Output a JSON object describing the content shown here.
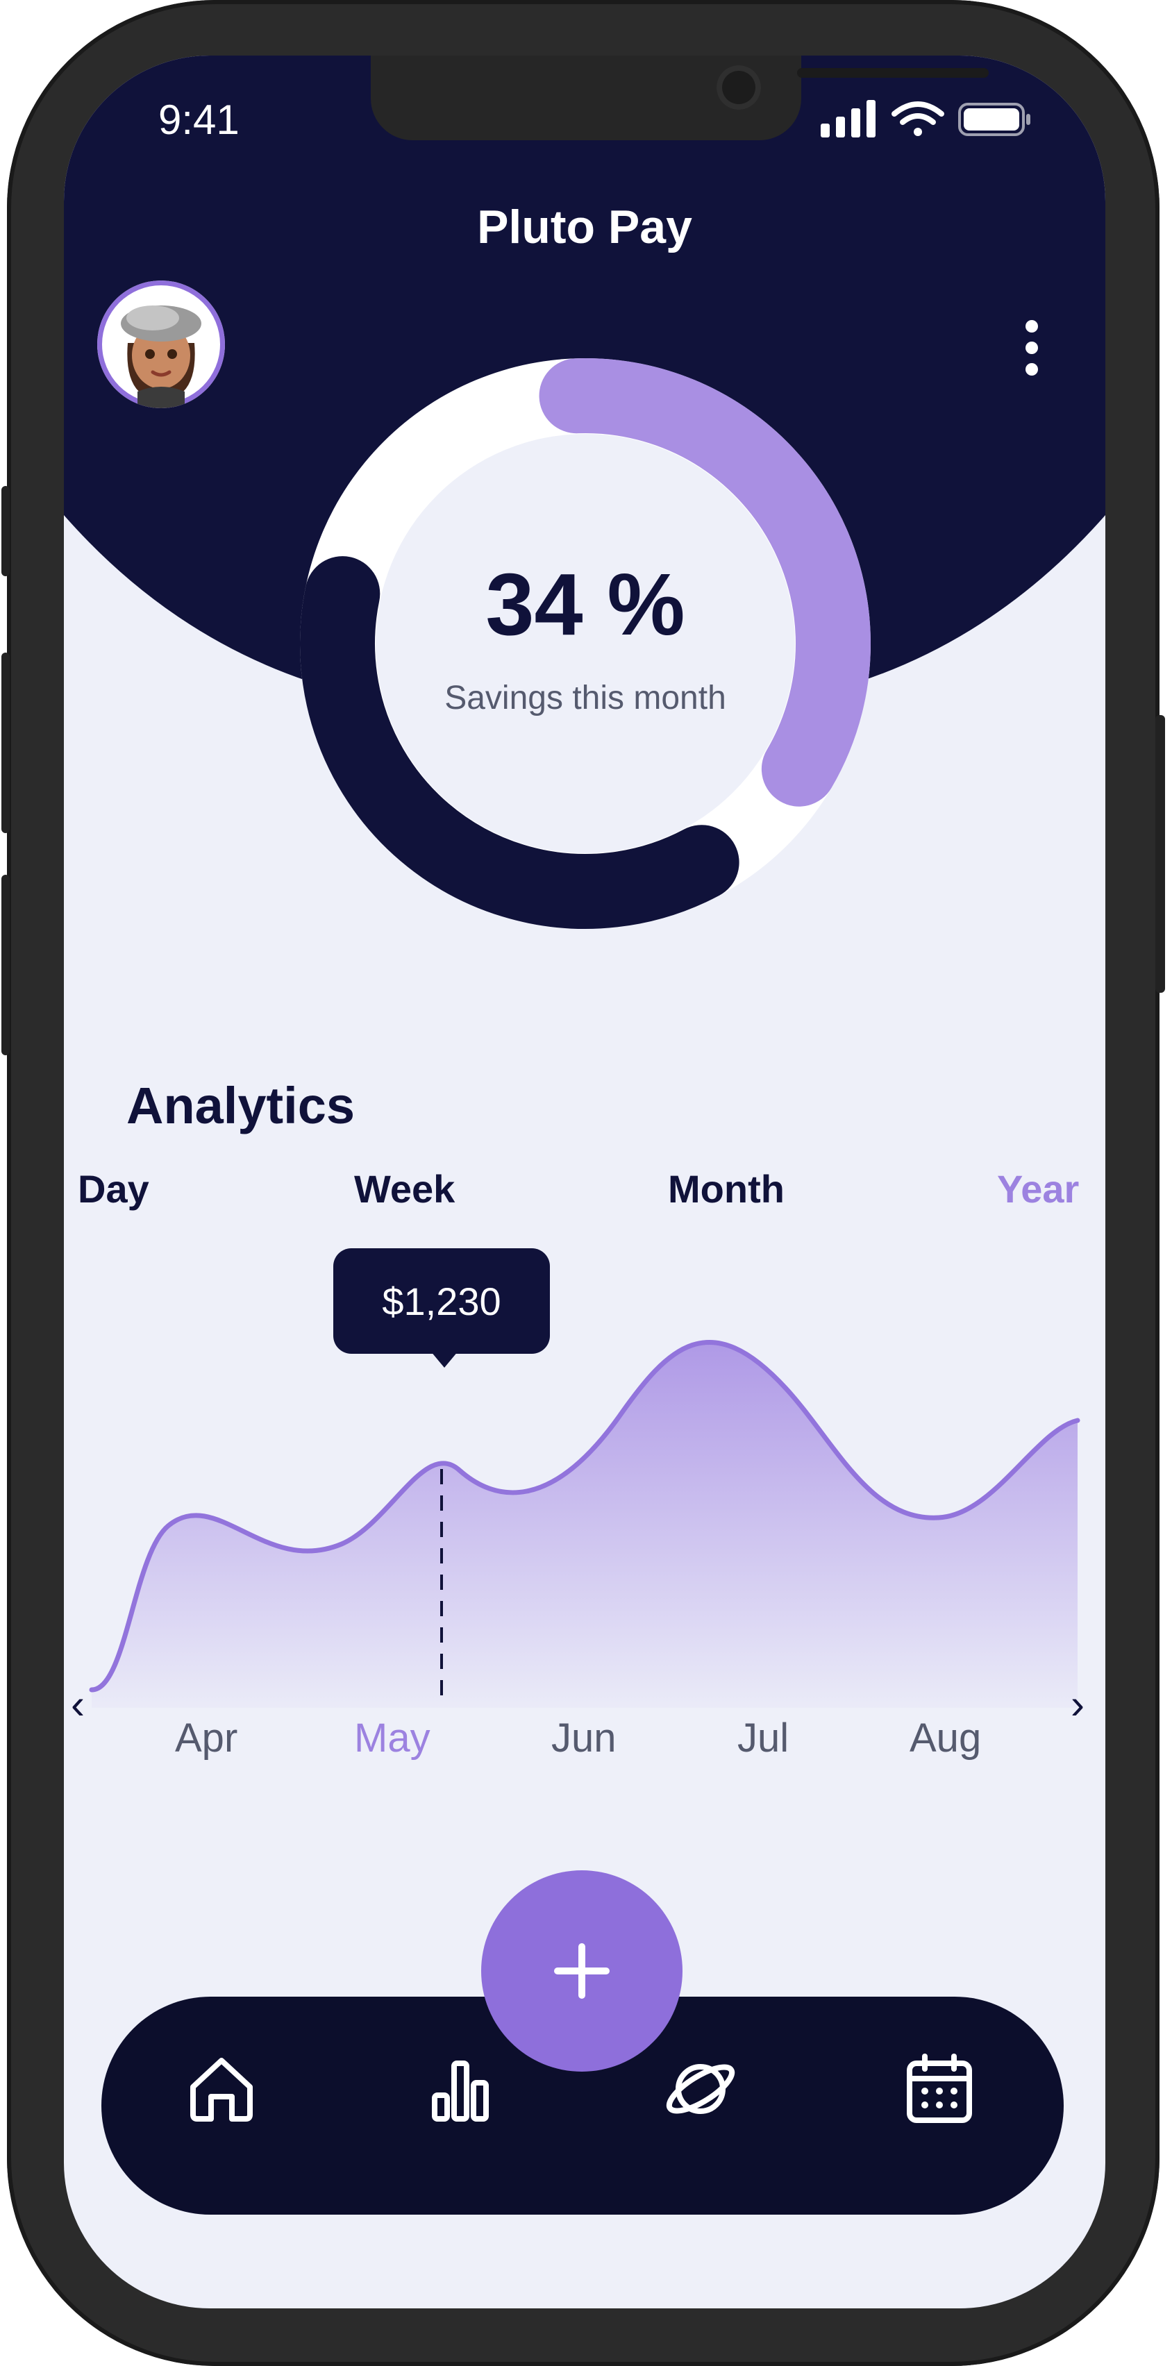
{
  "status_bar": {
    "time": "9:41"
  },
  "header": {
    "title": "Pluto Pay"
  },
  "savings": {
    "percent_text": "34 %",
    "percent_value": 34,
    "label": "Savings this month"
  },
  "analytics": {
    "title": "Analytics",
    "ranges": [
      "Day",
      "Week",
      "Month",
      "Year"
    ],
    "selected_range": "Year",
    "tooltip_value": "$1,230",
    "months": [
      "Apr",
      "May",
      "Jun",
      "Jul",
      "Aug"
    ],
    "selected_month": "May"
  },
  "colors": {
    "navy": "#10123a",
    "accent": "#8e6fdb",
    "accent_light": "#a98fe3",
    "background": "#eef0f9"
  },
  "icons": {
    "nav": [
      "home-icon",
      "bar-chart-icon",
      "planet-icon",
      "calendar-icon"
    ],
    "fab": "plus-icon",
    "menu": "more-vertical-icon"
  }
}
